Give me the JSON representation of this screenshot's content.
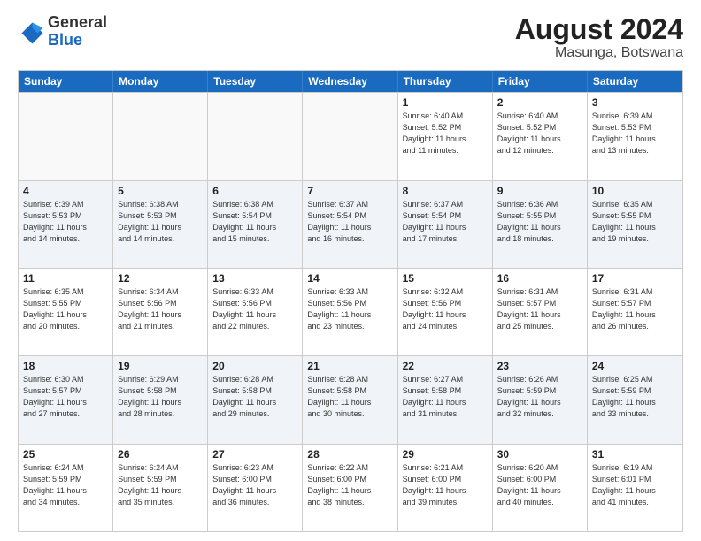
{
  "header": {
    "logo_general": "General",
    "logo_blue": "Blue",
    "month_year": "August 2024",
    "location": "Masunga, Botswana"
  },
  "weekdays": [
    "Sunday",
    "Monday",
    "Tuesday",
    "Wednesday",
    "Thursday",
    "Friday",
    "Saturday"
  ],
  "weeks": [
    [
      {
        "day": "",
        "info": ""
      },
      {
        "day": "",
        "info": ""
      },
      {
        "day": "",
        "info": ""
      },
      {
        "day": "",
        "info": ""
      },
      {
        "day": "1",
        "info": "Sunrise: 6:40 AM\nSunset: 5:52 PM\nDaylight: 11 hours\nand 11 minutes."
      },
      {
        "day": "2",
        "info": "Sunrise: 6:40 AM\nSunset: 5:52 PM\nDaylight: 11 hours\nand 12 minutes."
      },
      {
        "day": "3",
        "info": "Sunrise: 6:39 AM\nSunset: 5:53 PM\nDaylight: 11 hours\nand 13 minutes."
      }
    ],
    [
      {
        "day": "4",
        "info": "Sunrise: 6:39 AM\nSunset: 5:53 PM\nDaylight: 11 hours\nand 14 minutes."
      },
      {
        "day": "5",
        "info": "Sunrise: 6:38 AM\nSunset: 5:53 PM\nDaylight: 11 hours\nand 14 minutes."
      },
      {
        "day": "6",
        "info": "Sunrise: 6:38 AM\nSunset: 5:54 PM\nDaylight: 11 hours\nand 15 minutes."
      },
      {
        "day": "7",
        "info": "Sunrise: 6:37 AM\nSunset: 5:54 PM\nDaylight: 11 hours\nand 16 minutes."
      },
      {
        "day": "8",
        "info": "Sunrise: 6:37 AM\nSunset: 5:54 PM\nDaylight: 11 hours\nand 17 minutes."
      },
      {
        "day": "9",
        "info": "Sunrise: 6:36 AM\nSunset: 5:55 PM\nDaylight: 11 hours\nand 18 minutes."
      },
      {
        "day": "10",
        "info": "Sunrise: 6:35 AM\nSunset: 5:55 PM\nDaylight: 11 hours\nand 19 minutes."
      }
    ],
    [
      {
        "day": "11",
        "info": "Sunrise: 6:35 AM\nSunset: 5:55 PM\nDaylight: 11 hours\nand 20 minutes."
      },
      {
        "day": "12",
        "info": "Sunrise: 6:34 AM\nSunset: 5:56 PM\nDaylight: 11 hours\nand 21 minutes."
      },
      {
        "day": "13",
        "info": "Sunrise: 6:33 AM\nSunset: 5:56 PM\nDaylight: 11 hours\nand 22 minutes."
      },
      {
        "day": "14",
        "info": "Sunrise: 6:33 AM\nSunset: 5:56 PM\nDaylight: 11 hours\nand 23 minutes."
      },
      {
        "day": "15",
        "info": "Sunrise: 6:32 AM\nSunset: 5:56 PM\nDaylight: 11 hours\nand 24 minutes."
      },
      {
        "day": "16",
        "info": "Sunrise: 6:31 AM\nSunset: 5:57 PM\nDaylight: 11 hours\nand 25 minutes."
      },
      {
        "day": "17",
        "info": "Sunrise: 6:31 AM\nSunset: 5:57 PM\nDaylight: 11 hours\nand 26 minutes."
      }
    ],
    [
      {
        "day": "18",
        "info": "Sunrise: 6:30 AM\nSunset: 5:57 PM\nDaylight: 11 hours\nand 27 minutes."
      },
      {
        "day": "19",
        "info": "Sunrise: 6:29 AM\nSunset: 5:58 PM\nDaylight: 11 hours\nand 28 minutes."
      },
      {
        "day": "20",
        "info": "Sunrise: 6:28 AM\nSunset: 5:58 PM\nDaylight: 11 hours\nand 29 minutes."
      },
      {
        "day": "21",
        "info": "Sunrise: 6:28 AM\nSunset: 5:58 PM\nDaylight: 11 hours\nand 30 minutes."
      },
      {
        "day": "22",
        "info": "Sunrise: 6:27 AM\nSunset: 5:58 PM\nDaylight: 11 hours\nand 31 minutes."
      },
      {
        "day": "23",
        "info": "Sunrise: 6:26 AM\nSunset: 5:59 PM\nDaylight: 11 hours\nand 32 minutes."
      },
      {
        "day": "24",
        "info": "Sunrise: 6:25 AM\nSunset: 5:59 PM\nDaylight: 11 hours\nand 33 minutes."
      }
    ],
    [
      {
        "day": "25",
        "info": "Sunrise: 6:24 AM\nSunset: 5:59 PM\nDaylight: 11 hours\nand 34 minutes."
      },
      {
        "day": "26",
        "info": "Sunrise: 6:24 AM\nSunset: 5:59 PM\nDaylight: 11 hours\nand 35 minutes."
      },
      {
        "day": "27",
        "info": "Sunrise: 6:23 AM\nSunset: 6:00 PM\nDaylight: 11 hours\nand 36 minutes."
      },
      {
        "day": "28",
        "info": "Sunrise: 6:22 AM\nSunset: 6:00 PM\nDaylight: 11 hours\nand 38 minutes."
      },
      {
        "day": "29",
        "info": "Sunrise: 6:21 AM\nSunset: 6:00 PM\nDaylight: 11 hours\nand 39 minutes."
      },
      {
        "day": "30",
        "info": "Sunrise: 6:20 AM\nSunset: 6:00 PM\nDaylight: 11 hours\nand 40 minutes."
      },
      {
        "day": "31",
        "info": "Sunrise: 6:19 AM\nSunset: 6:01 PM\nDaylight: 11 hours\nand 41 minutes."
      }
    ]
  ]
}
